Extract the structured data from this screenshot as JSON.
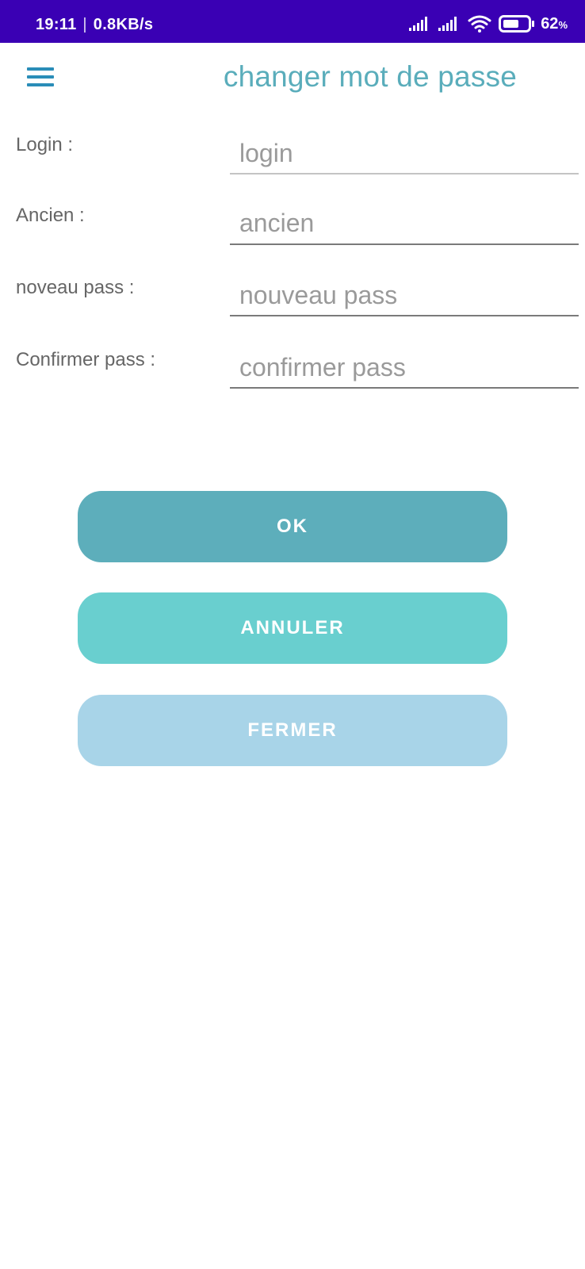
{
  "status_bar": {
    "time": "19:11",
    "separator": "|",
    "speed": "0.8KB/s",
    "battery_percent": "62",
    "battery_unit": "%",
    "icons": [
      "signal-icon",
      "signal-icon",
      "wifi-icon",
      "battery-icon"
    ],
    "background": "#3a00b4"
  },
  "app_bar": {
    "title": "changer mot de passe",
    "menu_icon": "hamburger-menu-icon",
    "title_color": "#5aadbb"
  },
  "form": {
    "fields": [
      {
        "label": "Login :",
        "placeholder": "login",
        "value": ""
      },
      {
        "label": "Ancien :",
        "placeholder": "ancien",
        "value": ""
      },
      {
        "label": "noveau pass :",
        "placeholder": "nouveau pass",
        "value": ""
      },
      {
        "label": "Confirmer pass :",
        "placeholder": "confirmer pass",
        "value": ""
      }
    ]
  },
  "actions": {
    "ok": {
      "label": "OK",
      "color": "#5daebb"
    },
    "annuler": {
      "label": "ANNULER",
      "color": "#69cfcf"
    },
    "fermer": {
      "label": "FERMER",
      "color": "#a8d4e8"
    }
  }
}
